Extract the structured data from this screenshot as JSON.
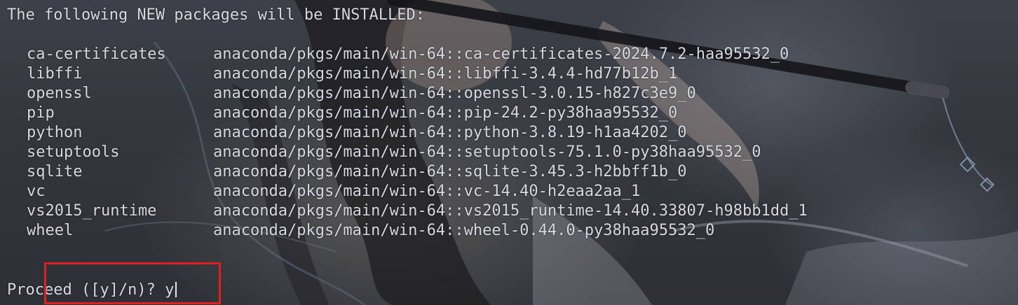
{
  "header": "The following NEW packages will be INSTALLED:",
  "packages": [
    {
      "name": "ca-certificates",
      "spec": "anaconda/pkgs/main/win-64::ca-certificates-2024.7.2-haa95532_0"
    },
    {
      "name": "libffi",
      "spec": "anaconda/pkgs/main/win-64::libffi-3.4.4-hd77b12b_1"
    },
    {
      "name": "openssl",
      "spec": "anaconda/pkgs/main/win-64::openssl-3.0.15-h827c3e9_0"
    },
    {
      "name": "pip",
      "spec": "anaconda/pkgs/main/win-64::pip-24.2-py38haa95532_0"
    },
    {
      "name": "python",
      "spec": "anaconda/pkgs/main/win-64::python-3.8.19-h1aa4202_0"
    },
    {
      "name": "setuptools",
      "spec": "anaconda/pkgs/main/win-64::setuptools-75.1.0-py38haa95532_0"
    },
    {
      "name": "sqlite",
      "spec": "anaconda/pkgs/main/win-64::sqlite-3.45.3-h2bbff1b_0"
    },
    {
      "name": "vc",
      "spec": "anaconda/pkgs/main/win-64::vc-14.40-h2eaa2aa_1"
    },
    {
      "name": "vs2015_runtime",
      "spec": "anaconda/pkgs/main/win-64::vs2015_runtime-14.40.33807-h98bb1dd_1"
    },
    {
      "name": "wheel",
      "spec": "anaconda/pkgs/main/win-64::wheel-0.44.0-py38haa95532_0"
    }
  ],
  "prompt": {
    "question": "Proceed ([y]/n)? ",
    "input": "y"
  },
  "colors": {
    "text": "#d6d9df",
    "highlight": "#e02020"
  }
}
